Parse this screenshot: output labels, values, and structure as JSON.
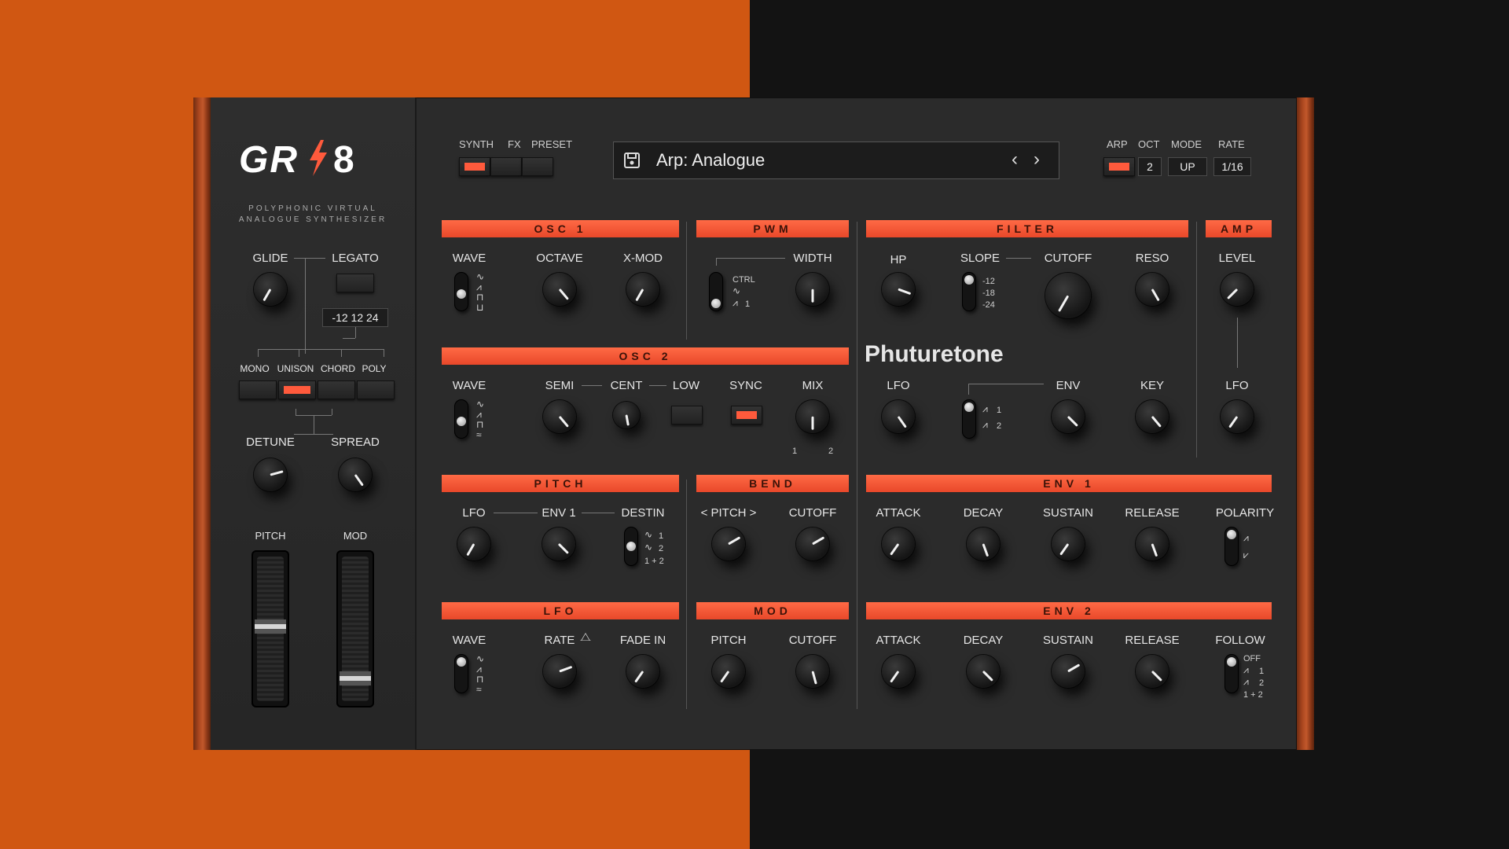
{
  "brand": {
    "logo_left": "GR",
    "logo_right": "8",
    "subtitle_line1": "POLYPHONIC VIRTUAL",
    "subtitle_line2": "ANALOGUE SYNTHESIZER",
    "bolt_color": "#ff5a3c"
  },
  "sidebar": {
    "glide": "GLIDE",
    "legato": "LEGATO",
    "legato_values": "-12  12  24",
    "modes": [
      "MONO",
      "UNISON",
      "CHORD",
      "POLY"
    ],
    "active_mode": "UNISON",
    "detune": "DETUNE",
    "spread": "SPREAD",
    "pitch": "PITCH",
    "mod": "MOD"
  },
  "top": {
    "page_tabs": [
      "SYNTH",
      "FX",
      "PRESET"
    ],
    "active_tab": "SYNTH",
    "preset_name": "Arp: Analogue",
    "prev_icon": "chevron-left-icon",
    "next_icon": "chevron-right-icon",
    "save_icon": "save-icon",
    "arp_labels": [
      "ARP",
      "OCT",
      "MODE",
      "RATE"
    ],
    "oct_value": "2",
    "mode_value": "UP",
    "rate_value": "1/16"
  },
  "sections": {
    "osc1": {
      "title": "OSC 1",
      "wave": "WAVE",
      "octave": "OCTAVE",
      "xmod": "X-MOD"
    },
    "pwm": {
      "title": "PWM",
      "ctrl": "CTRL",
      "ctrl_1": "1",
      "width": "WIDTH"
    },
    "filter": {
      "title": "FILTER",
      "hp": "HP",
      "slope": "SLOPE",
      "slope_values": [
        "-12",
        "-18",
        "-24"
      ],
      "cutoff": "CUTOFF",
      "reso": "RESO",
      "lfo": "LFO",
      "env": "ENV",
      "env_opts": [
        "1",
        "2"
      ],
      "key": "KEY",
      "brand_text": "Phuturetone"
    },
    "amp": {
      "title": "AMP",
      "level": "LEVEL",
      "lfo": "LFO"
    },
    "osc2": {
      "title": "OSC 2",
      "wave": "WAVE",
      "semi": "SEMI",
      "cent": "CENT",
      "low": "LOW",
      "sync": "SYNC",
      "mix": "MIX",
      "mix_1": "1",
      "mix_2": "2"
    },
    "pitch": {
      "title": "PITCH",
      "lfo": "LFO",
      "env1": "ENV 1",
      "destin": "DESTIN",
      "dest_opts": [
        "1",
        "2",
        "1 + 2"
      ]
    },
    "bend": {
      "title": "BEND",
      "pitch": "<  PITCH  >",
      "cutoff": "CUTOFF"
    },
    "env1": {
      "title": "ENV 1",
      "attack": "ATTACK",
      "decay": "DECAY",
      "sustain": "SUSTAIN",
      "release": "RELEASE",
      "polarity": "POLARITY"
    },
    "lfo": {
      "title": "LFO",
      "wave": "WAVE",
      "rate": "RATE",
      "fadein": "FADE IN"
    },
    "mod": {
      "title": "MOD",
      "pitch": "PITCH",
      "cutoff": "CUTOFF"
    },
    "env2": {
      "title": "ENV 2",
      "attack": "ATTACK",
      "decay": "DECAY",
      "sustain": "SUSTAIN",
      "release": "RELEASE",
      "follow": "FOLLOW",
      "follow_opts": [
        "OFF",
        "1",
        "2",
        "1 + 2"
      ]
    }
  },
  "knob_angles": {
    "glide": 30,
    "detune": -105,
    "spread": -35,
    "osc1_octave": -40,
    "osc1_xmod": 30,
    "pwm_width": 0,
    "hp": -70,
    "cutoff": 30,
    "reso": -30,
    "level": 45,
    "osc2_semi": -40,
    "osc2_cent": -10,
    "osc2_mix": 0,
    "f_lfo": -35,
    "f_env": -45,
    "f_key": -40,
    "amp_lfo": 35,
    "p_lfo": 30,
    "p_env1": -45,
    "b_pitch": -120,
    "b_cutoff": -120,
    "e1_attack": 35,
    "e1_decay": -20,
    "e1_sustain": 35,
    "e1_release": -20,
    "l_rate": -110,
    "l_fade": 35,
    "m_pitch": 35,
    "m_cutoff": -15,
    "e2_attack": 35,
    "e2_decay": -45,
    "e2_sustain": -120,
    "e2_release": -45
  },
  "colors": {
    "accent": "#ff5a3c",
    "orange_bg": "#d05712"
  }
}
